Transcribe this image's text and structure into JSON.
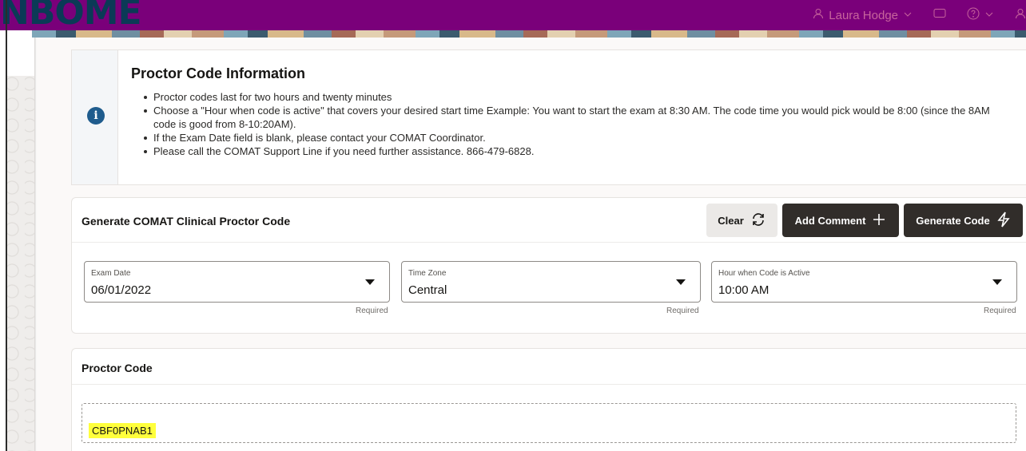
{
  "header": {
    "logo_text": "NBOME",
    "user_name": "Laura Hodge",
    "brand_color": "#7a007a"
  },
  "info": {
    "title": "Proctor Code Information",
    "icon": "info-icon",
    "bullets": [
      "Proctor codes last for two hours and twenty minutes",
      "Choose a \"Hour when code is active\" that covers your desired start time Example: You want to start the exam at 8:30 AM. The code time you would pick would be 8:00 (since the 8AM code is good from 8-10:20AM).",
      "If the Exam Date field is blank, please contact your COMAT Coordinator.",
      "Please call the COMAT Support Line if you need further assistance. 866-479-6828."
    ]
  },
  "generate": {
    "title": "Generate COMAT Clinical Proctor Code",
    "buttons": {
      "clear": "Clear",
      "add_comment": "Add Comment",
      "generate_code": "Generate Code"
    },
    "fields": {
      "exam_date": {
        "label": "Exam Date",
        "value": "06/01/2022",
        "hint": "Required"
      },
      "time_zone": {
        "label": "Time Zone",
        "value": "Central",
        "hint": "Required"
      },
      "hour_active": {
        "label": "Hour when Code is Active",
        "value": "10:00 AM",
        "hint": "Required"
      }
    }
  },
  "proctor": {
    "title": "Proctor Code",
    "code": "CBF0PNAB1",
    "highlight_color": "#ffff3c"
  }
}
